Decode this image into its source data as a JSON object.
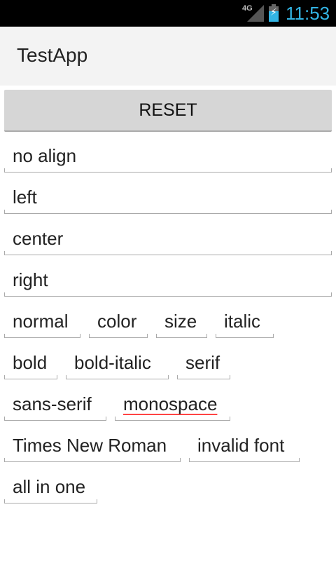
{
  "status_bar": {
    "network": "4G",
    "time": "11:53",
    "icons": [
      "signal-icon",
      "battery-charging-icon"
    ]
  },
  "app_bar": {
    "title": "TestApp"
  },
  "reset_label": "RESET",
  "fields": [
    "no align",
    "left",
    "center",
    "right",
    "normal",
    "color",
    "size",
    "italic",
    "bold",
    "bold-italic",
    "serif",
    "sans-serif",
    "monospace",
    "Times New Roman",
    "invalid font",
    "all in one"
  ],
  "spellcheck_color": "#ff4444"
}
